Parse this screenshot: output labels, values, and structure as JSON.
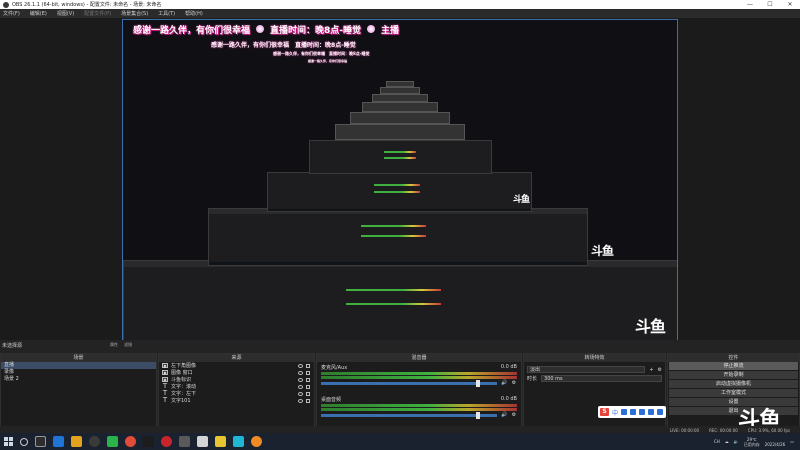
{
  "window": {
    "title": "OBS 26.1.1 (64-bit, windows) - 配置文件: 未命名 - 场景: 未命名"
  },
  "menu": [
    "文件(F)",
    "编辑(E)",
    "视图(V)",
    "配置文件(P)",
    "场景集合(S)",
    "工具(T)",
    "帮助(H)"
  ],
  "banner": {
    "text1": "感谢一路久伴，有你们很幸福",
    "text2": "直播时间：晚8点-睡觉",
    "text3": "主播"
  },
  "docks": {
    "studio_title": "未选择源",
    "top_buttons": [
      "属性",
      "滤镜"
    ],
    "scenes": {
      "title": "场景",
      "items": [
        "直播",
        "录像",
        "场景 2"
      ],
      "selected": 0
    },
    "sources": {
      "title": "来源",
      "items": [
        {
          "label": "左下角图像",
          "icon": "image-icon"
        },
        {
          "label": "图像 窗口",
          "icon": "image-icon"
        },
        {
          "label": "斗鱼标识",
          "icon": "image-icon"
        },
        {
          "label": "文字：滚动",
          "icon": "text-icon"
        },
        {
          "label": "文字：左下",
          "icon": "text-icon"
        },
        {
          "label": "文字101",
          "icon": "text-icon"
        }
      ]
    },
    "mixer": {
      "title": "混音器",
      "channels": [
        {
          "name": "麦克风/Aux",
          "db": "0.0 dB",
          "level": 0.88
        },
        {
          "name": "桌面音频",
          "db": "0.0 dB",
          "level": 0.88
        }
      ]
    },
    "transitions": {
      "title": "转场特效",
      "type": "淡出",
      "duration_label": "时长",
      "duration": "300 ms"
    },
    "controls": {
      "title": "控件",
      "buttons": [
        "停止推流",
        "开始录制",
        "启动虚拟摄像机",
        "工作室模式",
        "设置",
        "退出"
      ],
      "active": 0
    }
  },
  "ime": {
    "logo": "S",
    "lang": "中"
  },
  "logo_text": "斗鱼",
  "status": {
    "live": "LIVE: 00:00:00",
    "rec": "REC: 00:00:00",
    "cpu": "CPU: 3.9%, 60.00 fps"
  },
  "taskbar": {
    "tray_text": "CH",
    "temp": "29℃",
    "weather": "已用内存",
    "time": "",
    "date": "2022/4/26"
  },
  "colors": {
    "accent": "#3a6fb0",
    "banner_glow": "#e0289a",
    "background": "#1e1e1e"
  }
}
